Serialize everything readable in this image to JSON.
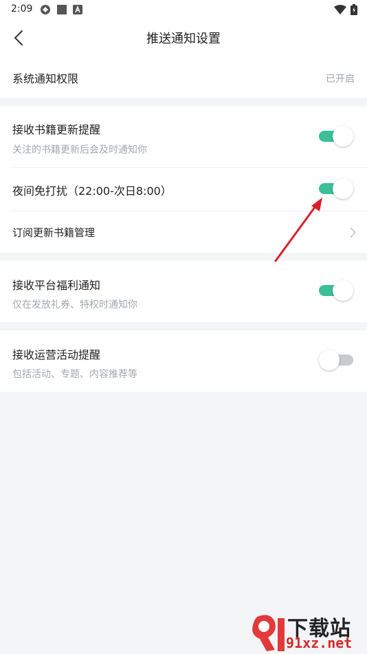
{
  "status_bar": {
    "time": "2:09"
  },
  "header": {
    "title": "推送通知设置"
  },
  "system_permission": {
    "label": "系统通知权限",
    "value": "已开启"
  },
  "book_updates": {
    "title": "接收书籍更新提醒",
    "subtitle": "关注的书籍更新后会及时通知你",
    "enabled": true
  },
  "night_mode": {
    "title": "夜间免打扰（22:00-次日8:00）",
    "enabled": true
  },
  "subscription": {
    "title": "订阅更新书籍管理"
  },
  "welfare": {
    "title": "接收平台福利通知",
    "subtitle": "仅在发放礼券、特权时通知你",
    "enabled": true
  },
  "operations": {
    "title": "接收运营活动提醒",
    "subtitle": "包括活动、专题、内容推荐等",
    "enabled": false
  },
  "colors": {
    "toggle_on": "#3bbf96",
    "toggle_off": "#c9cacd",
    "annotation_arrow": "#d9202a"
  },
  "watermark": {
    "name": "下载站",
    "url": "91xz.net"
  }
}
